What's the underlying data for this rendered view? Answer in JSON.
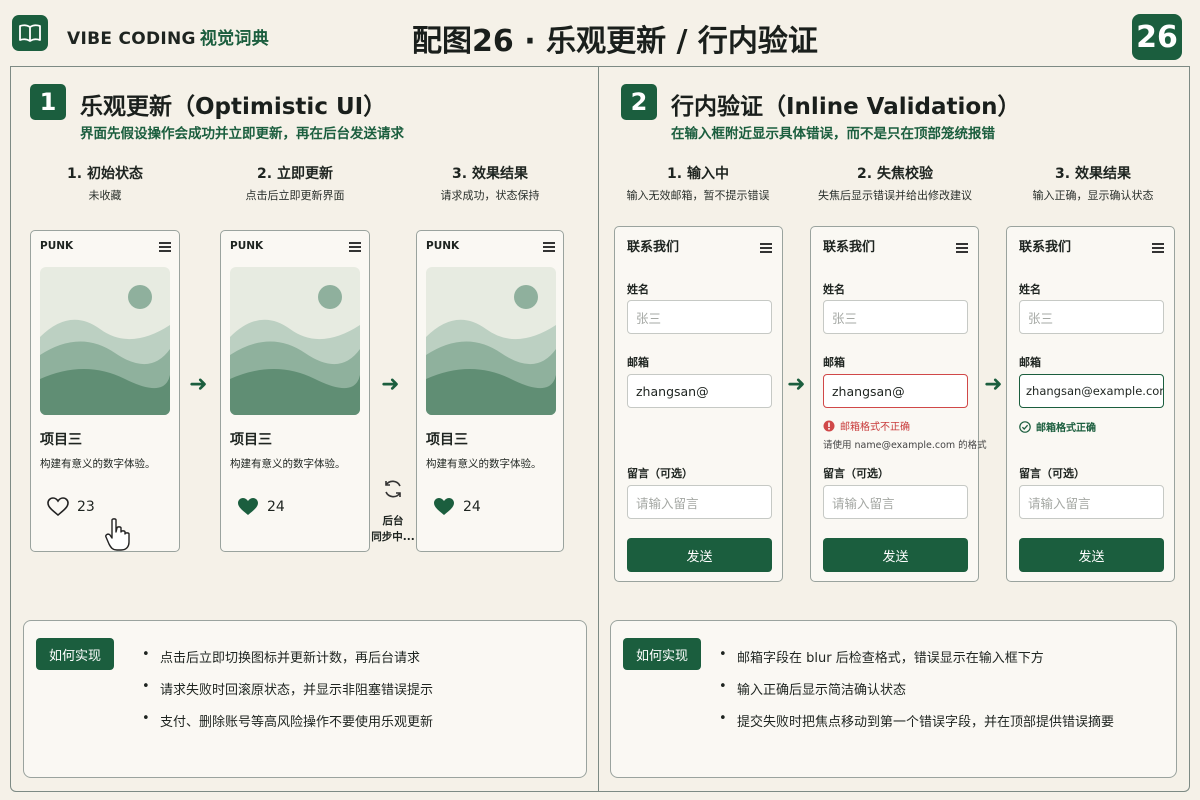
{
  "header": {
    "brand_en": "VIBE CODING",
    "brand_cn": "视觉词典",
    "title": "配图26 · 乐观更新 / 行内验证",
    "figure_number": "26",
    "logo_icon": "open-book-icon"
  },
  "section1": {
    "number": "1",
    "title": "乐观更新（Optimistic UI）",
    "subtitle": "界面先假设操作会成功并立即更新，再在后台发送请求",
    "steps": [
      {
        "title": "1. 初始状态",
        "desc": "未收藏"
      },
      {
        "title": "2. 立即更新",
        "desc": "点击后立即更新界面"
      },
      {
        "title": "3. 效果结果",
        "desc": "请求成功，状态保持"
      }
    ],
    "cards": [
      {
        "brand": "PUNK",
        "project": "项目三",
        "desc": "构建有意义的数字体验。",
        "likes": "23",
        "liked": false
      },
      {
        "brand": "PUNK",
        "project": "项目三",
        "desc": "构建有意义的数字体验。",
        "likes": "24",
        "liked": true
      },
      {
        "brand": "PUNK",
        "project": "项目三",
        "desc": "构建有意义的数字体验。",
        "likes": "24",
        "liked": true
      }
    ],
    "sync_label_1": "后台",
    "sync_label_2": "同步中...",
    "how_label": "如何实现",
    "bullets": [
      "点击后立即切换图标并更新计数，再后台请求",
      "请求失败时回滚原状态，并显示非阻塞错误提示",
      "支付、删除账号等高风险操作不要使用乐观更新"
    ]
  },
  "section2": {
    "number": "2",
    "title": "行内验证（Inline Validation）",
    "subtitle": "在输入框附近显示具体错误，而不是只在顶部笼统报错",
    "steps": [
      {
        "title": "1. 输入中",
        "desc": "输入无效邮箱，暂不提示错误"
      },
      {
        "title": "2. 失焦校验",
        "desc": "失焦后显示错误并给出修改建议"
      },
      {
        "title": "3. 效果结果",
        "desc": "输入正确，显示确认状态"
      }
    ],
    "forms": [
      {
        "title": "联系我们",
        "name_label": "姓名",
        "name_ph": "张三",
        "email_label": "邮箱",
        "email_value": "zhangsan@",
        "msg_label": "留言（可选）",
        "msg_ph": "请输入留言",
        "submit": "发送"
      },
      {
        "title": "联系我们",
        "name_label": "姓名",
        "name_ph": "张三",
        "email_label": "邮箱",
        "email_value": "zhangsan@",
        "error": "邮箱格式不正确",
        "hint": "请使用 name@example.com 的格式",
        "msg_label": "留言（可选）",
        "msg_ph": "请输入留言",
        "submit": "发送"
      },
      {
        "title": "联系我们",
        "name_label": "姓名",
        "name_ph": "张三",
        "email_label": "邮箱",
        "email_value": "zhangsan@example.com",
        "ok": "邮箱格式正确",
        "msg_label": "留言（可选）",
        "msg_ph": "请输入留言",
        "submit": "发送"
      }
    ],
    "how_label": "如何实现",
    "bullets": [
      "邮箱字段在 blur 后检查格式，错误显示在输入框下方",
      "输入正确后显示简洁确认状态",
      "提交失败时把焦点移动到第一个错误字段，并在顶部提供错误摘要"
    ]
  },
  "colors": {
    "accent": "#1b5e3e",
    "error": "#d04848",
    "background": "#f5f1e8"
  }
}
